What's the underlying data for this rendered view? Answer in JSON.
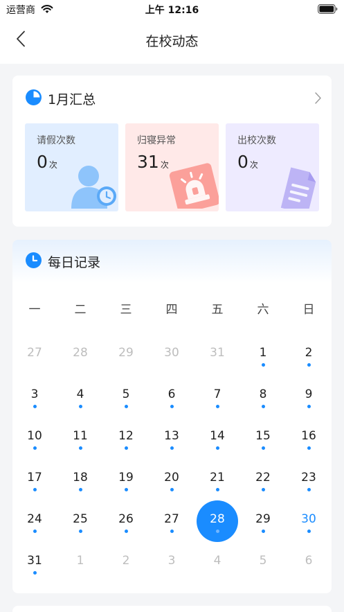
{
  "status_bar": {
    "carrier": "运营商",
    "time": "上午 12:16",
    "icons": [
      "wifi-icon",
      "battery-icon"
    ]
  },
  "nav": {
    "title": "在校动态",
    "back_icon": "chevron-left-icon"
  },
  "summary": {
    "title": "1月汇总",
    "title_icon": "pie-chart-icon",
    "arrow_icon": "chevron-right-icon",
    "stats": [
      {
        "label": "请假次数",
        "value": "0",
        "unit": "次",
        "icon": "person-clock-icon",
        "bg": "#e1eeff"
      },
      {
        "label": "归寝异常",
        "value": "31",
        "unit": "次",
        "icon": "alarm-light-icon",
        "bg": "#ffe9e8"
      },
      {
        "label": "出校次数",
        "value": "0",
        "unit": "次",
        "icon": "document-icon",
        "bg": "#eeebff"
      }
    ]
  },
  "daily": {
    "title": "每日记录",
    "title_icon": "clock-icon",
    "weekdays": [
      "一",
      "二",
      "三",
      "四",
      "五",
      "六",
      "日"
    ],
    "days": [
      {
        "label": "27",
        "state": "other"
      },
      {
        "label": "28",
        "state": "other"
      },
      {
        "label": "29",
        "state": "other"
      },
      {
        "label": "30",
        "state": "other"
      },
      {
        "label": "31",
        "state": "other"
      },
      {
        "label": "1",
        "state": "record"
      },
      {
        "label": "2",
        "state": "record"
      },
      {
        "label": "3",
        "state": "record"
      },
      {
        "label": "4",
        "state": "record"
      },
      {
        "label": "5",
        "state": "record"
      },
      {
        "label": "6",
        "state": "record"
      },
      {
        "label": "7",
        "state": "record"
      },
      {
        "label": "8",
        "state": "record"
      },
      {
        "label": "9",
        "state": "record"
      },
      {
        "label": "10",
        "state": "record"
      },
      {
        "label": "11",
        "state": "record"
      },
      {
        "label": "12",
        "state": "record"
      },
      {
        "label": "13",
        "state": "record"
      },
      {
        "label": "14",
        "state": "record"
      },
      {
        "label": "15",
        "state": "record"
      },
      {
        "label": "16",
        "state": "record"
      },
      {
        "label": "17",
        "state": "record"
      },
      {
        "label": "18",
        "state": "record"
      },
      {
        "label": "19",
        "state": "record"
      },
      {
        "label": "20",
        "state": "record"
      },
      {
        "label": "21",
        "state": "record"
      },
      {
        "label": "22",
        "state": "record"
      },
      {
        "label": "23",
        "state": "record"
      },
      {
        "label": "24",
        "state": "record"
      },
      {
        "label": "25",
        "state": "record"
      },
      {
        "label": "26",
        "state": "record"
      },
      {
        "label": "27",
        "state": "record"
      },
      {
        "label": "28",
        "state": "selected"
      },
      {
        "label": "29",
        "state": "record"
      },
      {
        "label": "30",
        "state": "today"
      },
      {
        "label": "31",
        "state": "record"
      },
      {
        "label": "1",
        "state": "other"
      },
      {
        "label": "2",
        "state": "other"
      },
      {
        "label": "3",
        "state": "other"
      },
      {
        "label": "4",
        "state": "other"
      },
      {
        "label": "5",
        "state": "other"
      },
      {
        "label": "6",
        "state": "other"
      }
    ]
  },
  "colors": {
    "accent": "#1a8cff",
    "text": "#1f1f1f",
    "muted": "#bdbdbd",
    "background": "#f4f5f7"
  }
}
